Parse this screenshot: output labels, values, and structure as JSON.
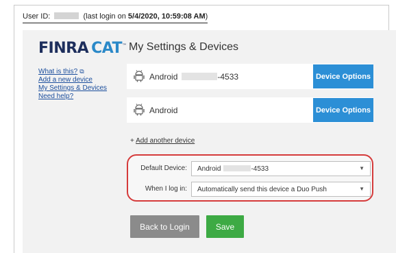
{
  "header": {
    "user_id_label": "User ID:",
    "last_login_prefix": "(last login on",
    "last_login_value": "5/4/2020, 10:59:08 AM",
    "last_login_suffix": ")"
  },
  "brand": {
    "name_part1": "FINRA",
    "name_part2": "CAT",
    "tm": "™"
  },
  "sidebar": {
    "items": [
      {
        "label": "What is this?"
      },
      {
        "label": "Add a new device"
      },
      {
        "label": "My Settings & Devices"
      },
      {
        "label": "Need help?"
      }
    ]
  },
  "main": {
    "title": "My Settings & Devices",
    "devices": [
      {
        "name": "Android",
        "suffix": "-4533",
        "button": "Device Options"
      },
      {
        "name": "Android",
        "suffix": "",
        "button": "Device Options"
      }
    ],
    "add_prefix": "+",
    "add_label": "Add another device",
    "preferences": {
      "default_device_label": "Default Device:",
      "default_device_value": "Android",
      "default_device_suffix": "-4533",
      "when_login_label": "When I log in:",
      "when_login_value": "Automatically send this device a Duo Push"
    },
    "buttons": {
      "back": "Back to Login",
      "save": "Save"
    }
  },
  "colors": {
    "brand_navy": "#1d2e5c",
    "brand_blue": "#2b89c8",
    "device_button": "#2c8fd6",
    "back_button": "#8b8b8b",
    "save_button": "#3daa44",
    "highlight_border": "#d53a3a"
  }
}
